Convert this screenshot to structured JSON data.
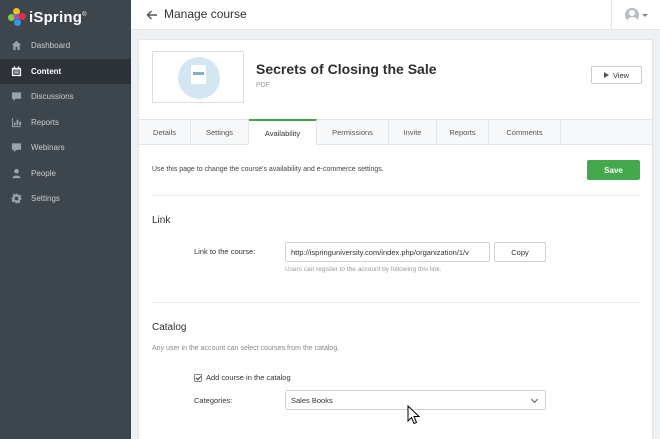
{
  "app": {
    "logo_text": "iSpring",
    "logo_mark": "®"
  },
  "sidebar": {
    "items": [
      {
        "label": "Dashboard",
        "icon": "home-icon",
        "active": false
      },
      {
        "label": "Content",
        "icon": "content-icon",
        "active": true
      },
      {
        "label": "Discussions",
        "icon": "chat-icon",
        "active": false
      },
      {
        "label": "Reports",
        "icon": "bar-chart-icon",
        "active": false
      },
      {
        "label": "Webinars",
        "icon": "webinar-icon",
        "active": false
      },
      {
        "label": "People",
        "icon": "person-icon",
        "active": false
      },
      {
        "label": "Settings",
        "icon": "gear-icon",
        "active": false
      }
    ]
  },
  "header": {
    "title": "Manage course"
  },
  "course": {
    "title": "Secrets of Closing the Sale",
    "type": "PDF",
    "view_label": "View"
  },
  "tabs": [
    {
      "label": "Details",
      "active": false
    },
    {
      "label": "Settings",
      "active": false
    },
    {
      "label": "Availability",
      "active": true
    },
    {
      "label": "Permissions",
      "active": false
    },
    {
      "label": "Invite",
      "active": false
    },
    {
      "label": "Reports",
      "active": false
    },
    {
      "label": "Comments",
      "active": false
    }
  ],
  "availability": {
    "intro": "Use this page to change the course's availability and e-commerce settings.",
    "save_label": "Save",
    "link": {
      "title": "Link",
      "label": "Link to the course:",
      "value": "http://ispringuniversity.com/index.php/organization/1/v",
      "copy_label": "Copy",
      "hint": "Users can register to the account by following this link."
    },
    "catalog": {
      "title": "Catalog",
      "description": "Any user in the account can select courses from the catalog.",
      "checkbox_label": "Add course in the catalog",
      "checked": true,
      "categories_label": "Categories:",
      "categories_value": "Sales Books"
    }
  },
  "colors": {
    "sidebar_bg": "#3d454d",
    "sidebar_active": "#2c3238",
    "accent_green": "#44a94d",
    "thumb_circle": "#d3e6f1"
  }
}
